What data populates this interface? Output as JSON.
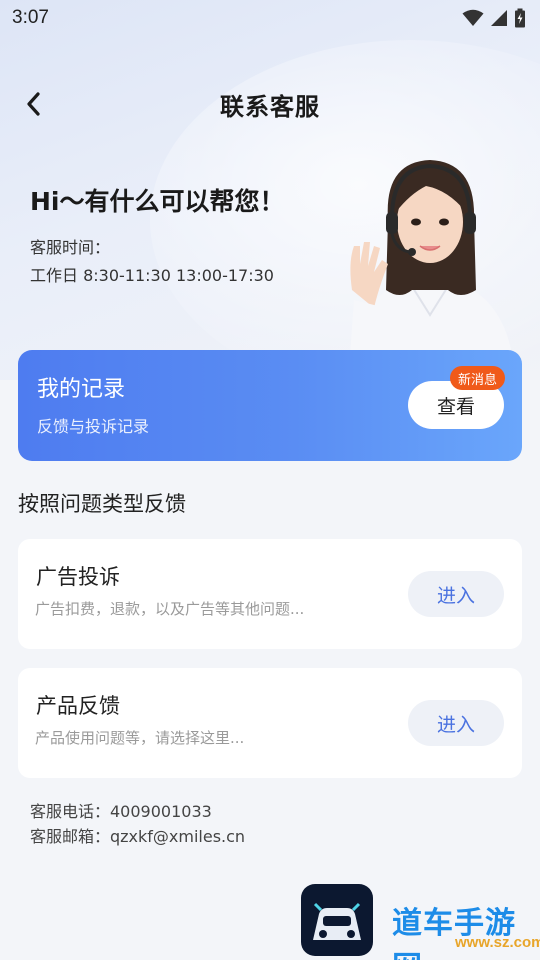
{
  "status_bar": {
    "time": "3:07",
    "icons": [
      "wifi-icon",
      "signal-icon",
      "battery-icon"
    ]
  },
  "header": {
    "title": "联系客服",
    "back_icon": "chevron-left-icon"
  },
  "hero": {
    "greeting": "Hi～有什么可以帮您！",
    "hours_label": "客服时间：",
    "hours_value": "工作日 8:30-11:30 13:00-17:30",
    "illustration": "customer-service-agent"
  },
  "records": {
    "title": "我的记录",
    "subtitle": "反馈与投诉记录",
    "view_label": "查看",
    "badge": "新消息"
  },
  "feedback_section": {
    "title": "按照问题类型反馈",
    "items": [
      {
        "title": "广告投诉",
        "desc": "广告扣费，退款，以及广告等其他问题...",
        "button": "进入"
      },
      {
        "title": "产品反馈",
        "desc": "产品使用问题等，请选择这里...",
        "button": "进入"
      }
    ]
  },
  "contact": {
    "phone": "客服电话：4009001033",
    "email": "客服邮箱：qzxkf@xmiles.cn"
  },
  "watermark": {
    "text": "道车手游网",
    "url": "www.sz.com"
  },
  "colors": {
    "accent": "#4e7cf0",
    "badge": "#f05a1a",
    "enter_text": "#4a72e0"
  }
}
